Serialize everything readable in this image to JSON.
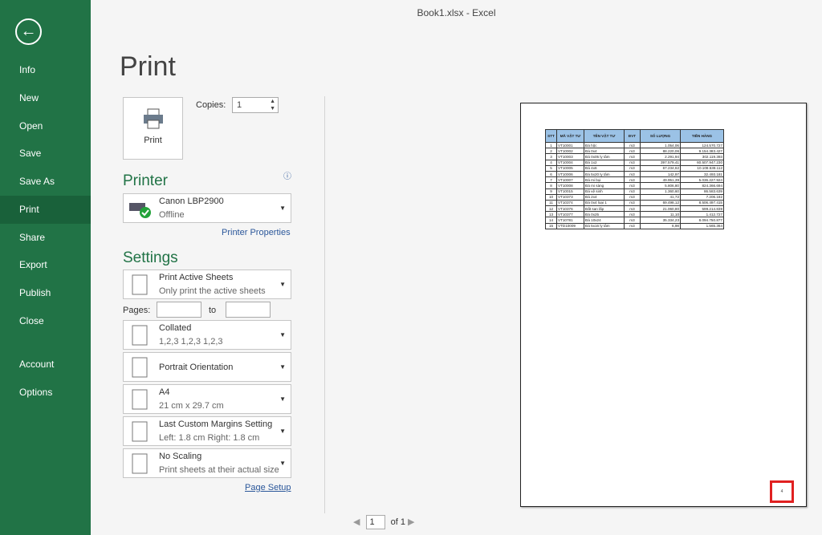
{
  "window_title": "Book1.xlsx - Excel",
  "sidebar": {
    "items": [
      {
        "label": "Info"
      },
      {
        "label": "New"
      },
      {
        "label": "Open"
      },
      {
        "label": "Save"
      },
      {
        "label": "Save As"
      },
      {
        "label": "Print"
      },
      {
        "label": "Share"
      },
      {
        "label": "Export"
      },
      {
        "label": "Publish"
      },
      {
        "label": "Close"
      },
      {
        "label": "Account"
      },
      {
        "label": "Options"
      }
    ],
    "active": "Print"
  },
  "heading": "Print",
  "print_button": "Print",
  "copies": {
    "label": "Copies:",
    "value": "1"
  },
  "printer": {
    "heading": "Printer",
    "name": "Canon LBP2900",
    "status": "Offline",
    "properties_link": "Printer Properties"
  },
  "settings": {
    "heading": "Settings",
    "items": [
      {
        "title": "Print Active Sheets",
        "sub": "Only print the active sheets"
      },
      {
        "title": "Collated",
        "sub": "1,2,3    1,2,3    1,2,3"
      },
      {
        "title": "Portrait Orientation",
        "sub": ""
      },
      {
        "title": "A4",
        "sub": "21 cm x 29.7 cm"
      },
      {
        "title": "Last Custom Margins Setting",
        "sub": "Left:  1.8 cm    Right:  1.8 cm"
      },
      {
        "title": "No Scaling",
        "sub": "Print sheets at their actual size"
      }
    ],
    "pages_label": "Pages:",
    "to_label": "to",
    "page_setup_link": "Page Setup"
  },
  "preview": {
    "headers": [
      "STT",
      "MÃ VẬT TƯ",
      "TÊN VẬT TƯ",
      "ĐVT",
      "SỐ LƯỢNG",
      "TIỀN HÀNG"
    ],
    "rows": [
      [
        "1",
        "VT10001",
        "Đá hộc",
        "m3",
        "1.054,06",
        "124.570.727"
      ],
      [
        "2",
        "VT10002",
        "Đá 0x4",
        "m3",
        "88.220,06",
        "9.154.383.427"
      ],
      [
        "3",
        "VT10003",
        "Đá 0x05 ly tâm",
        "m3",
        "2.291,94",
        "302.119.393"
      ],
      [
        "4",
        "VT10004",
        "Đá 1x2",
        "m3",
        "397.579,41",
        "60.507.947.230"
      ],
      [
        "5",
        "VT10005",
        "Đá 4x6",
        "m3",
        "67.234,62",
        "10.108.538.112"
      ],
      [
        "6",
        "VT10006",
        "Đá 5x20 ly tâm",
        "m3",
        "142,97",
        "32.493.181"
      ],
      [
        "7",
        "VT10007",
        "Đá mi bụi",
        "m3",
        "49.951,39",
        "5.036.227.924"
      ],
      [
        "8",
        "VT10008",
        "Đá mi sàng",
        "m3",
        "5.806,80",
        "824.366.694"
      ],
      [
        "9",
        "VT10015",
        "Đá vệ sinh",
        "m3",
        "1.360,60",
        "86.583.639"
      ],
      [
        "10",
        "VT10373",
        "Đá 2x4",
        "m3",
        "41,72",
        "7.206.182"
      ],
      [
        "11",
        "VT10374",
        "Đá 0x4 loại 1",
        "m3",
        "69.498,12",
        "8.506.497.415"
      ],
      [
        "12",
        "VT10376",
        "Đất san lấp",
        "m3",
        "21.060,80",
        "599.214.839"
      ],
      [
        "13",
        "VT10377",
        "Đá 0x25",
        "m3",
        "11,10",
        "1.412.727"
      ],
      [
        "14",
        "VT10781",
        "Đá 10x24",
        "m3",
        "35.334,23",
        "8.094.750.877"
      ],
      [
        "15",
        "VTD10009",
        "Đá 5x16 ly tâm",
        "m3",
        "6,98",
        "1.565.364"
      ]
    ],
    "page_number": "4"
  },
  "pager": {
    "current": "1",
    "of": "of 1"
  },
  "colors": {
    "brand": "#217346",
    "highlight": "#e02020"
  }
}
